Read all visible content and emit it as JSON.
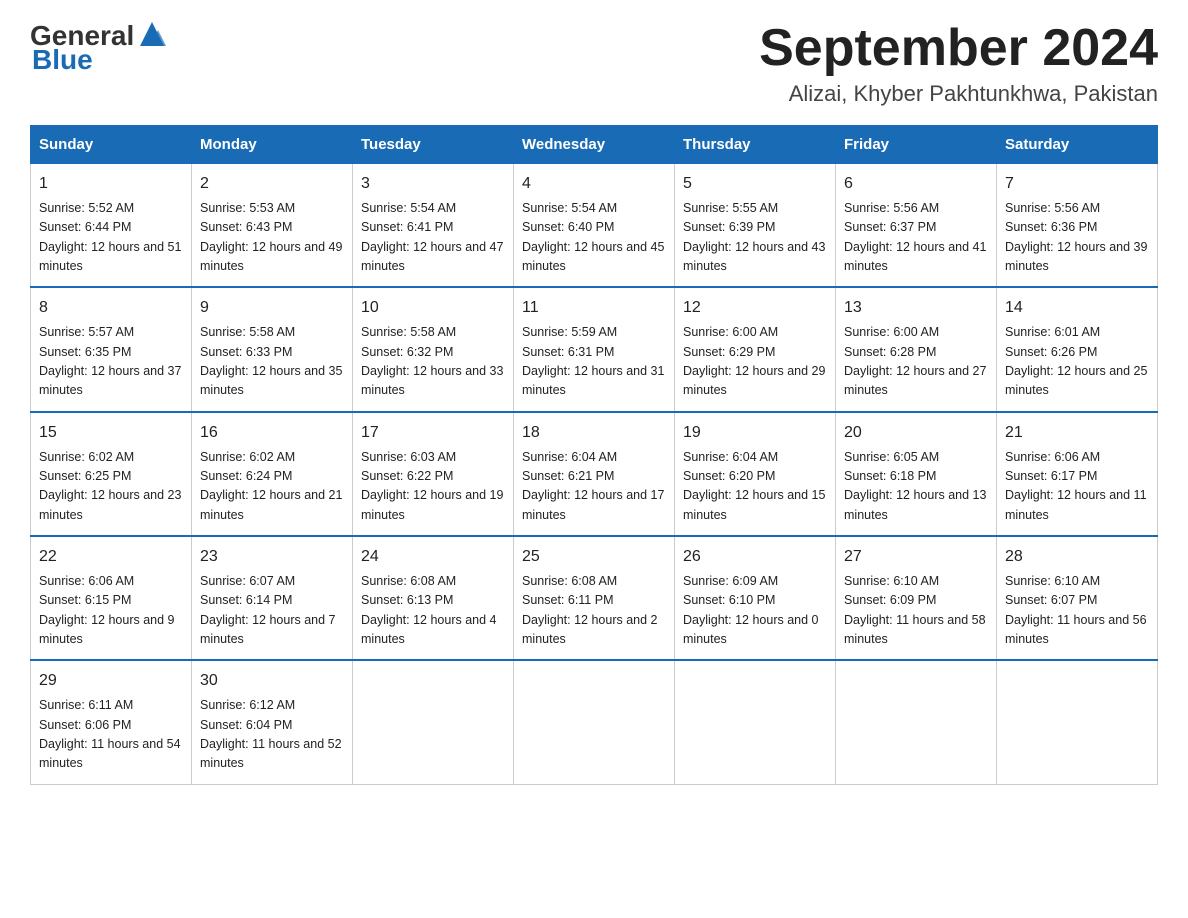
{
  "header": {
    "logo_general": "General",
    "logo_blue": "Blue",
    "month_title": "September 2024",
    "location": "Alizai, Khyber Pakhtunkhwa, Pakistan"
  },
  "days_of_week": [
    "Sunday",
    "Monday",
    "Tuesday",
    "Wednesday",
    "Thursday",
    "Friday",
    "Saturday"
  ],
  "weeks": [
    [
      {
        "day": "1",
        "sunrise": "5:52 AM",
        "sunset": "6:44 PM",
        "daylight": "12 hours and 51 minutes."
      },
      {
        "day": "2",
        "sunrise": "5:53 AM",
        "sunset": "6:43 PM",
        "daylight": "12 hours and 49 minutes."
      },
      {
        "day": "3",
        "sunrise": "5:54 AM",
        "sunset": "6:41 PM",
        "daylight": "12 hours and 47 minutes."
      },
      {
        "day": "4",
        "sunrise": "5:54 AM",
        "sunset": "6:40 PM",
        "daylight": "12 hours and 45 minutes."
      },
      {
        "day": "5",
        "sunrise": "5:55 AM",
        "sunset": "6:39 PM",
        "daylight": "12 hours and 43 minutes."
      },
      {
        "day": "6",
        "sunrise": "5:56 AM",
        "sunset": "6:37 PM",
        "daylight": "12 hours and 41 minutes."
      },
      {
        "day": "7",
        "sunrise": "5:56 AM",
        "sunset": "6:36 PM",
        "daylight": "12 hours and 39 minutes."
      }
    ],
    [
      {
        "day": "8",
        "sunrise": "5:57 AM",
        "sunset": "6:35 PM",
        "daylight": "12 hours and 37 minutes."
      },
      {
        "day": "9",
        "sunrise": "5:58 AM",
        "sunset": "6:33 PM",
        "daylight": "12 hours and 35 minutes."
      },
      {
        "day": "10",
        "sunrise": "5:58 AM",
        "sunset": "6:32 PM",
        "daylight": "12 hours and 33 minutes."
      },
      {
        "day": "11",
        "sunrise": "5:59 AM",
        "sunset": "6:31 PM",
        "daylight": "12 hours and 31 minutes."
      },
      {
        "day": "12",
        "sunrise": "6:00 AM",
        "sunset": "6:29 PM",
        "daylight": "12 hours and 29 minutes."
      },
      {
        "day": "13",
        "sunrise": "6:00 AM",
        "sunset": "6:28 PM",
        "daylight": "12 hours and 27 minutes."
      },
      {
        "day": "14",
        "sunrise": "6:01 AM",
        "sunset": "6:26 PM",
        "daylight": "12 hours and 25 minutes."
      }
    ],
    [
      {
        "day": "15",
        "sunrise": "6:02 AM",
        "sunset": "6:25 PM",
        "daylight": "12 hours and 23 minutes."
      },
      {
        "day": "16",
        "sunrise": "6:02 AM",
        "sunset": "6:24 PM",
        "daylight": "12 hours and 21 minutes."
      },
      {
        "day": "17",
        "sunrise": "6:03 AM",
        "sunset": "6:22 PM",
        "daylight": "12 hours and 19 minutes."
      },
      {
        "day": "18",
        "sunrise": "6:04 AM",
        "sunset": "6:21 PM",
        "daylight": "12 hours and 17 minutes."
      },
      {
        "day": "19",
        "sunrise": "6:04 AM",
        "sunset": "6:20 PM",
        "daylight": "12 hours and 15 minutes."
      },
      {
        "day": "20",
        "sunrise": "6:05 AM",
        "sunset": "6:18 PM",
        "daylight": "12 hours and 13 minutes."
      },
      {
        "day": "21",
        "sunrise": "6:06 AM",
        "sunset": "6:17 PM",
        "daylight": "12 hours and 11 minutes."
      }
    ],
    [
      {
        "day": "22",
        "sunrise": "6:06 AM",
        "sunset": "6:15 PM",
        "daylight": "12 hours and 9 minutes."
      },
      {
        "day": "23",
        "sunrise": "6:07 AM",
        "sunset": "6:14 PM",
        "daylight": "12 hours and 7 minutes."
      },
      {
        "day": "24",
        "sunrise": "6:08 AM",
        "sunset": "6:13 PM",
        "daylight": "12 hours and 4 minutes."
      },
      {
        "day": "25",
        "sunrise": "6:08 AM",
        "sunset": "6:11 PM",
        "daylight": "12 hours and 2 minutes."
      },
      {
        "day": "26",
        "sunrise": "6:09 AM",
        "sunset": "6:10 PM",
        "daylight": "12 hours and 0 minutes."
      },
      {
        "day": "27",
        "sunrise": "6:10 AM",
        "sunset": "6:09 PM",
        "daylight": "11 hours and 58 minutes."
      },
      {
        "day": "28",
        "sunrise": "6:10 AM",
        "sunset": "6:07 PM",
        "daylight": "11 hours and 56 minutes."
      }
    ],
    [
      {
        "day": "29",
        "sunrise": "6:11 AM",
        "sunset": "6:06 PM",
        "daylight": "11 hours and 54 minutes."
      },
      {
        "day": "30",
        "sunrise": "6:12 AM",
        "sunset": "6:04 PM",
        "daylight": "11 hours and 52 minutes."
      },
      null,
      null,
      null,
      null,
      null
    ]
  ],
  "labels": {
    "sunrise": "Sunrise:",
    "sunset": "Sunset:",
    "daylight": "Daylight:"
  },
  "colors": {
    "header_bg": "#1a6bb5",
    "header_text": "#ffffff",
    "border": "#cccccc",
    "week_separator": "#1a6bb5"
  }
}
